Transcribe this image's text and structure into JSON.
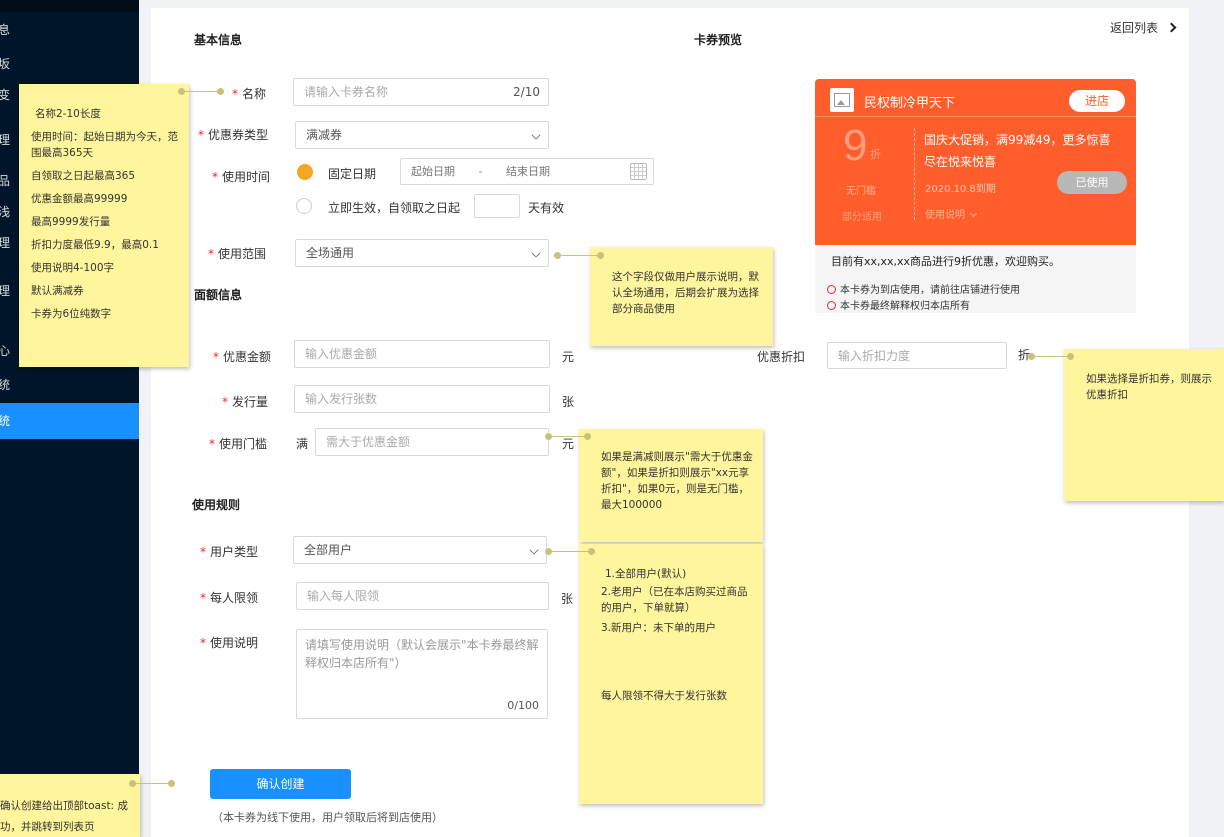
{
  "sidebar": {
    "items": [
      {
        "label": "息"
      },
      {
        "label": "坂"
      },
      {
        "label": "变"
      },
      {
        "label": "理"
      },
      {
        "label": "品"
      },
      {
        "label": "浅"
      },
      {
        "label": "理"
      },
      {
        "label": "理"
      },
      {
        "label": "心"
      },
      {
        "label": "统"
      },
      {
        "label": "统"
      }
    ]
  },
  "header": {
    "basic_info_title": "基本信息",
    "preview_title": "卡券预览",
    "back_link": "返回列表"
  },
  "form": {
    "name_label": "名称",
    "name_placeholder": "请输入卡券名称",
    "name_counter": "2/10",
    "coupon_type_label": "优惠券类型",
    "coupon_type_value": "满减券",
    "use_time_label": "使用时间",
    "fixed_date_label": "固定日期",
    "start_date_placeholder": "起始日期",
    "date_separator": "-",
    "end_date_placeholder": "结束日期",
    "immediate_label": "立即生效，自领取之日起",
    "days_unit": "天有效",
    "scope_label": "使用范围",
    "scope_value": "全场通用",
    "amount_section_title": "面额信息",
    "discount_amount_label": "优惠金额",
    "discount_amount_placeholder": "输入优惠金额",
    "yuan_unit": "元",
    "issue_count_label": "发行量",
    "issue_count_placeholder": "输入发行张数",
    "sheet_unit": "张",
    "threshold_label": "使用门槛",
    "threshold_prefix": "满",
    "threshold_placeholder": "需大于优惠金额",
    "threshold_unit": "元",
    "discount_rate_label": "优惠折扣",
    "discount_rate_placeholder": "输入折扣力度",
    "discount_rate_unit": "折",
    "rules_section_title": "使用规则",
    "user_type_label": "用户类型",
    "user_type_value": "全部用户",
    "per_limit_label": "每人限领",
    "per_limit_placeholder": "输入每人限领",
    "per_limit_unit": "张",
    "instructions_label": "使用说明",
    "instructions_placeholder": "请填写使用说明（默认会展示\"本卡券最终解释权归本店所有\"）",
    "instructions_counter": "0/100",
    "submit_label": "确认创建",
    "submit_hint": "（本卡券为线下使用，用户领取后将到店使用）"
  },
  "card": {
    "shop_name": "民权制冷甲天下",
    "enter_button": "进店",
    "discount_value": "9",
    "discount_unit": "折",
    "no_threshold": "无门槛",
    "partial_scope": "部分适用",
    "promo_line1": "国庆大促销，满99减49，更多惊喜",
    "promo_line2": "尽在悦来悦喜",
    "expiry": "2020.10.8到期",
    "instructions_toggle": "使用说明",
    "used_button": "已使用",
    "summary": "目前有xx,xx,xx商品进行9折优惠，欢迎购买。",
    "note1": "本卡券为到店使用，请前往店铺进行使用",
    "note2": "本卡券最终解释权归本店所有"
  },
  "notes": {
    "left_main": [
      "名称2-10长度",
      "使用时间：起始日期为今天，范围最高365天",
      "自领取之日起最高365",
      "优惠金额最高99999",
      "最高9999发行量",
      "折扣力度最低9.9，最高0.1",
      "使用说明4-100字",
      "默认满减券",
      "卡券为6位纯数字"
    ],
    "scope_note": "这个字段仅做用户展示说明，默认全场通用，后期会扩展为选择部分商品使用",
    "discount_note": "如果选择是折扣券，则展示优惠折扣",
    "threshold_note": "如果是满减则展示\"需大于优惠金额\"，如果是折扣则展示\"xx元享折扣\"，如果0元，则是无门槛，最大100000",
    "user_type_note": [
      "1.全部用户(默认)",
      "2.老用户（已在本店购买过商品的用户，下单就算）",
      "3.新用户：未下单的用户"
    ],
    "limit_note": "每人限领不得大于发行张数",
    "bottom_left_note": "确认创建给出顶部toast:\n成功，并跳转到列表页"
  },
  "colors": {
    "sidebar_bg": "#001529",
    "primary": "#1890ff",
    "card_orange": "#ff5e2c",
    "note_yellow": "#fff59d"
  }
}
